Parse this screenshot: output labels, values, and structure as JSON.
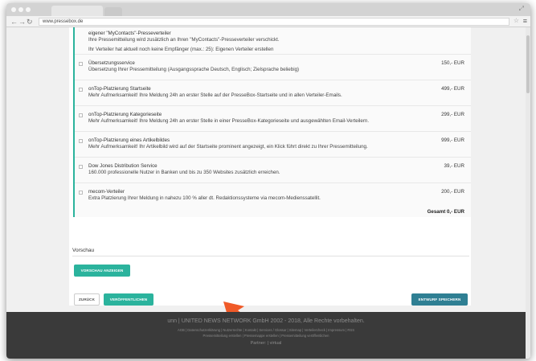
{
  "browser": {
    "url": "www.pressebox.de"
  },
  "top_entry": {
    "title": "eigener \"MyContacts\"-Presseverteiler",
    "desc": "Ihre Pressemitteilung wird zusätzlich an Ihren \"MyContacts\"-Presseverteiler verschickt.",
    "note": "Ihr Verteiler hat aktuell noch keine Empfänger (max.: 25): Eigenen Verteiler erstellen"
  },
  "services": [
    {
      "title": "Übersetzungsservice",
      "desc": "Übersetzung Ihrer Pressemitteilung (Ausgangssprache Deutsch, Englisch; Zielsprache beliebig)",
      "price": "150,- EUR"
    },
    {
      "title": "onTop-Platzierung Startseite",
      "desc": "Mehr Aufmerksamkeit! Ihre Meldung 24h an erster Stelle auf der PresseBox-Startseite und in allen Verteiler-Emails.",
      "price": "499,- EUR"
    },
    {
      "title": "onTop-Platzierung Kategorieseite",
      "desc": "Mehr Aufmerksamkeit! Ihre Meldung 24h an erster Stelle in einer PresseBox-Kategorieseite und ausgewählten Email-Verteilern.",
      "price": "299,- EUR"
    },
    {
      "title": "onTop-Platzierung eines Artikelbildes",
      "desc": "Mehr Aufmerksamkeit! Ihr Artikelbild wird auf der Startseite prominent angezeigt, ein Klick führt direkt zu Ihrer Pressemitteilung.",
      "price": "999,- EUR"
    },
    {
      "title": "Dow Jones Distribution Service",
      "desc": "160.000 professionelle Nutzer in Banken und bis zu 350 Websites zusätzlich erreichen.",
      "price": "39,- EUR"
    },
    {
      "title": "mecom-Verteiler",
      "desc": "Extra Platzierung Ihrer Meldung in nahezu 100 % aller dt. Redaktionssysteme via mecom-Medienssatellit.",
      "price": "200,- EUR"
    }
  ],
  "total": "Gesamt 0,- EUR",
  "preview": {
    "title": "Vorschau",
    "button": "VORSCHAU ANZEIGEN"
  },
  "actions": {
    "back": "ZURÜCK",
    "publish": "VERÖFFENTLICHEN",
    "draft": "ENTWURF SPEICHERN"
  },
  "footer": {
    "line1": "unn | UNITED NEWS NETWORK GmbH 2002 - 2018, Alle Rechte vorbehalten.",
    "line2": "AGB | Datenschutzerklärung | Nutzerrechte | Kontakt | Services / Glossar | Sitemap | Verteilercheck | Impressum | RSS",
    "line3": "Pressemitteilung erstellen | Pressemappe erstellen | Pressemitteilung veröffentlichen",
    "line4": "Partner: | virtual"
  },
  "colors": {
    "accent": "#2bb39d",
    "draft_button": "#2f7f93",
    "arrow": "#f05a28",
    "footer_bg": "#3a3a3a"
  }
}
